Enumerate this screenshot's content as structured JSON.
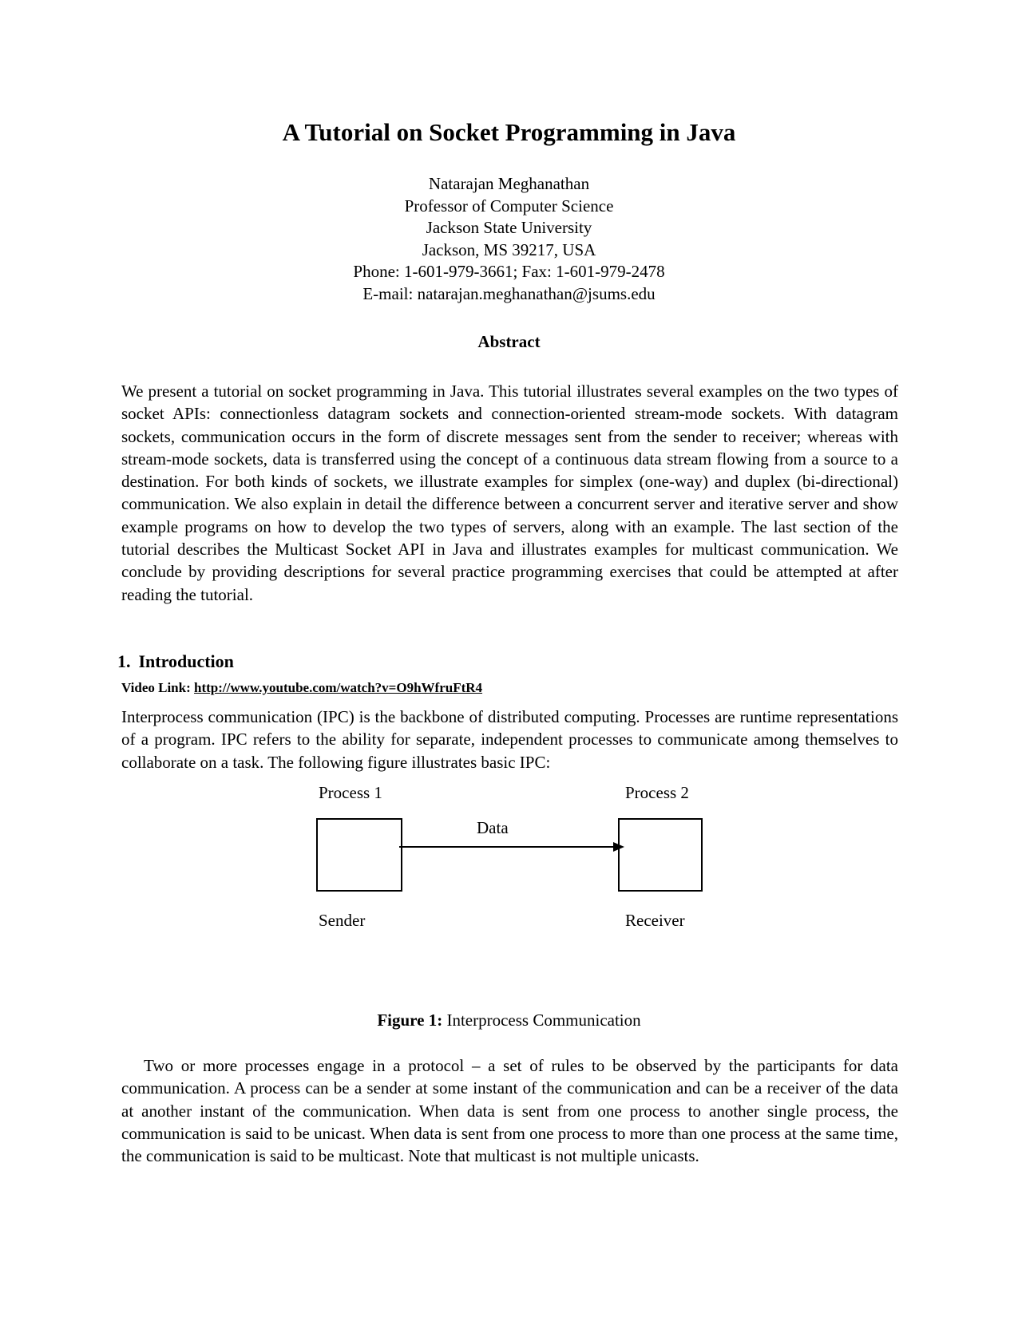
{
  "title": "A Tutorial on Socket Programming in Java",
  "author": {
    "name": "Natarajan Meghanathan",
    "position": "Professor of Computer Science",
    "institution": "Jackson State University",
    "address": "Jackson, MS 39217, USA",
    "phone_fax": "Phone: 1-601-979-3661; Fax: 1-601-979-2478",
    "email": "E-mail: natarajan.meghanathan@jsums.edu"
  },
  "abstract": {
    "heading": "Abstract",
    "text": "We present a tutorial on socket programming in Java. This tutorial illustrates several examples on the two types of socket APIs: connectionless datagram sockets and connection-oriented stream-mode sockets. With datagram sockets, communication occurs in the form of discrete messages sent from the sender to receiver; whereas with stream-mode sockets, data is transferred using the concept of a continuous data stream flowing from a source to a destination. For both kinds of sockets, we illustrate examples for simplex (one-way) and duplex (bi-directional) communication. We also explain in detail the difference between a concurrent server and iterative server and show example programs on how to develop the two types of servers, along with an example. The last section of the tutorial describes the Multicast Socket API in Java and illustrates examples for multicast communication. We conclude by providing descriptions for several practice programming exercises that could be attempted at after reading the tutorial."
  },
  "section1": {
    "number": "1.",
    "heading": "Introduction",
    "video_label": "Video Link:",
    "video_url": "http://www.youtube.com/watch?v=O9hWfruFtR4",
    "paragraph1": "Interprocess communication (IPC) is the backbone of distributed computing. Processes are runtime representations of a program. IPC refers to the ability for separate, independent processes to communicate among themselves to collaborate on a task. The following figure illustrates basic IPC:",
    "paragraph2": "Two or more processes engage in a protocol – a set of rules to be observed by the participants for data communication. A process can be a sender at some instant of the communication and can be a receiver of the data at another instant of the communication. When data is sent from one process to another single process, the communication is said to be unicast. When data is sent from one process to more than one process at the same time, the communication is said to be multicast. Note that multicast is not multiple unicasts."
  },
  "figure1": {
    "process1_label": "Process 1",
    "process2_label": "Process 2",
    "arrow_label": "Data",
    "sender_label": "Sender",
    "receiver_label": "Receiver",
    "caption_prefix": "Figure 1:",
    "caption_text": " Interprocess Communication"
  }
}
